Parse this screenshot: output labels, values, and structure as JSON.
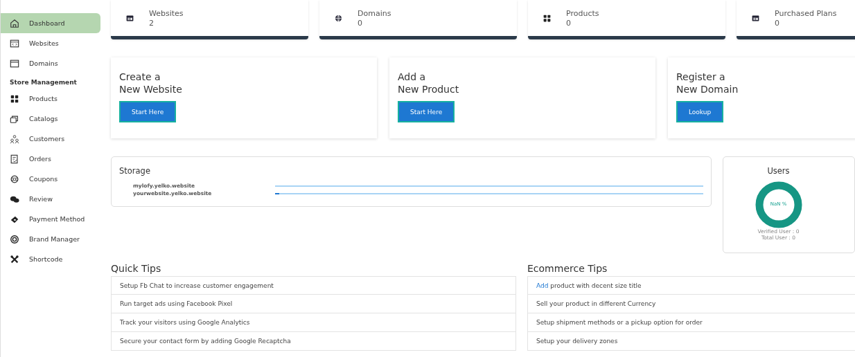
{
  "sidebar": {
    "items": [
      {
        "label": "Dashboard",
        "selected": true
      },
      {
        "label": "Websites",
        "selected": false
      },
      {
        "label": "Domains",
        "selected": false
      }
    ],
    "section": "Store Management",
    "store_items": [
      {
        "label": "Products",
        "selected": false
      },
      {
        "label": "Catalogs",
        "selected": false
      },
      {
        "label": "Customers",
        "selected": false
      },
      {
        "label": "Orders",
        "selected": false
      },
      {
        "label": "Coupons",
        "selected": false
      },
      {
        "label": "Review",
        "selected": false
      },
      {
        "label": "Payment Method",
        "selected": false
      },
      {
        "label": "Brand Manager",
        "selected": false
      },
      {
        "label": "Shortcode",
        "selected": false
      }
    ]
  },
  "stats": [
    {
      "label": "Websites",
      "value": "2"
    },
    {
      "label": "Domains",
      "value": "0"
    },
    {
      "label": "Products",
      "value": "0"
    },
    {
      "label": "Purchased Plans",
      "value": "0"
    }
  ],
  "actions": [
    {
      "title_line_1": "Create a",
      "title_line_2": "New Website",
      "button": "Start Here"
    },
    {
      "title_line_1": "Add a",
      "title_line_2": "New Product",
      "button": "Start Here"
    },
    {
      "title_line_1": "Register a",
      "title_line_2": "New Domain",
      "button": "Lookup"
    }
  ],
  "storage": {
    "title": "Storage",
    "sites": [
      {
        "name": "mylofy.yelko.website"
      },
      {
        "name": "yourwebsite.yelko.website",
        "level": 0.01
      }
    ]
  },
  "users": {
    "title": "Users",
    "percent": "NaN %",
    "verified": "Verified User : 0",
    "total": "Total User : 0"
  },
  "quick_tips": {
    "title": "Quick Tips",
    "items": [
      {
        "text": "Setup Fb Chat to increase customer engagement"
      },
      {
        "text": "Run target ads using Facebook Pixel"
      },
      {
        "text": "Track your visitors using Google Analytics"
      },
      {
        "text": "Secure your contact form by adding Google Recaptcha"
      }
    ]
  },
  "ecommerce_tips": {
    "title": "Ecommerce Tips",
    "items": [
      {
        "link": "Add",
        "text": " product with decent size title"
      },
      {
        "text": "Sell your product in different Currency"
      },
      {
        "text": "Setup shipment methods or a pickup option for order"
      },
      {
        "text": "Setup your delivery zones"
      }
    ]
  }
}
